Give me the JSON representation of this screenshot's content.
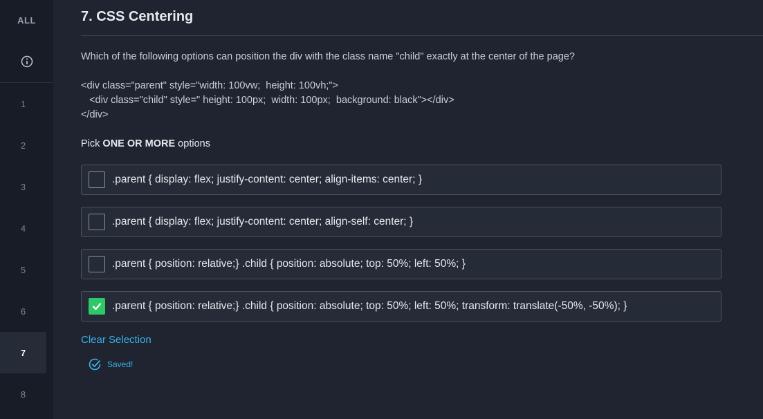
{
  "sidebar": {
    "all_label": "ALL",
    "info_icon": "info-circle-icon",
    "items": [
      {
        "label": "1"
      },
      {
        "label": "2"
      },
      {
        "label": "3"
      },
      {
        "label": "4"
      },
      {
        "label": "5"
      },
      {
        "label": "6"
      },
      {
        "label": "7",
        "active": true
      },
      {
        "label": "8"
      }
    ]
  },
  "question": {
    "title": "7. CSS Centering",
    "prompt": "Which of the following options can position the div with the class name \"child\" exactly at the center of the page?",
    "code": [
      "<div class=\"parent\" style=\"width: 100vw;  height: 100vh;\">",
      "   <div class=\"child\" style=\" height: 100px;  width: 100px;  background: black\"></div>",
      "</div>"
    ],
    "pick_prefix": "Pick ",
    "pick_emphasis": "ONE OR MORE",
    "pick_suffix": " options"
  },
  "options": [
    {
      "text": ".parent { display: flex; justify-content: center; align-items: center; }",
      "checked": false
    },
    {
      "text": ".parent { display: flex; justify-content: center; align-self: center; }",
      "checked": false
    },
    {
      "text": ".parent { position: relative;} .child { position: absolute; top: 50%; left: 50%; }",
      "checked": false
    },
    {
      "text": ".parent { position: relative;} .child { position: absolute; top: 50%; left: 50%; transform: translate(-50%, -50%); }",
      "checked": true
    }
  ],
  "actions": {
    "clear_label": "Clear Selection",
    "saved_label": "Saved!"
  },
  "colors": {
    "accent": "#39b1e8",
    "checked": "#2ec866",
    "background": "#1f2430",
    "sidebar": "#171c26"
  }
}
